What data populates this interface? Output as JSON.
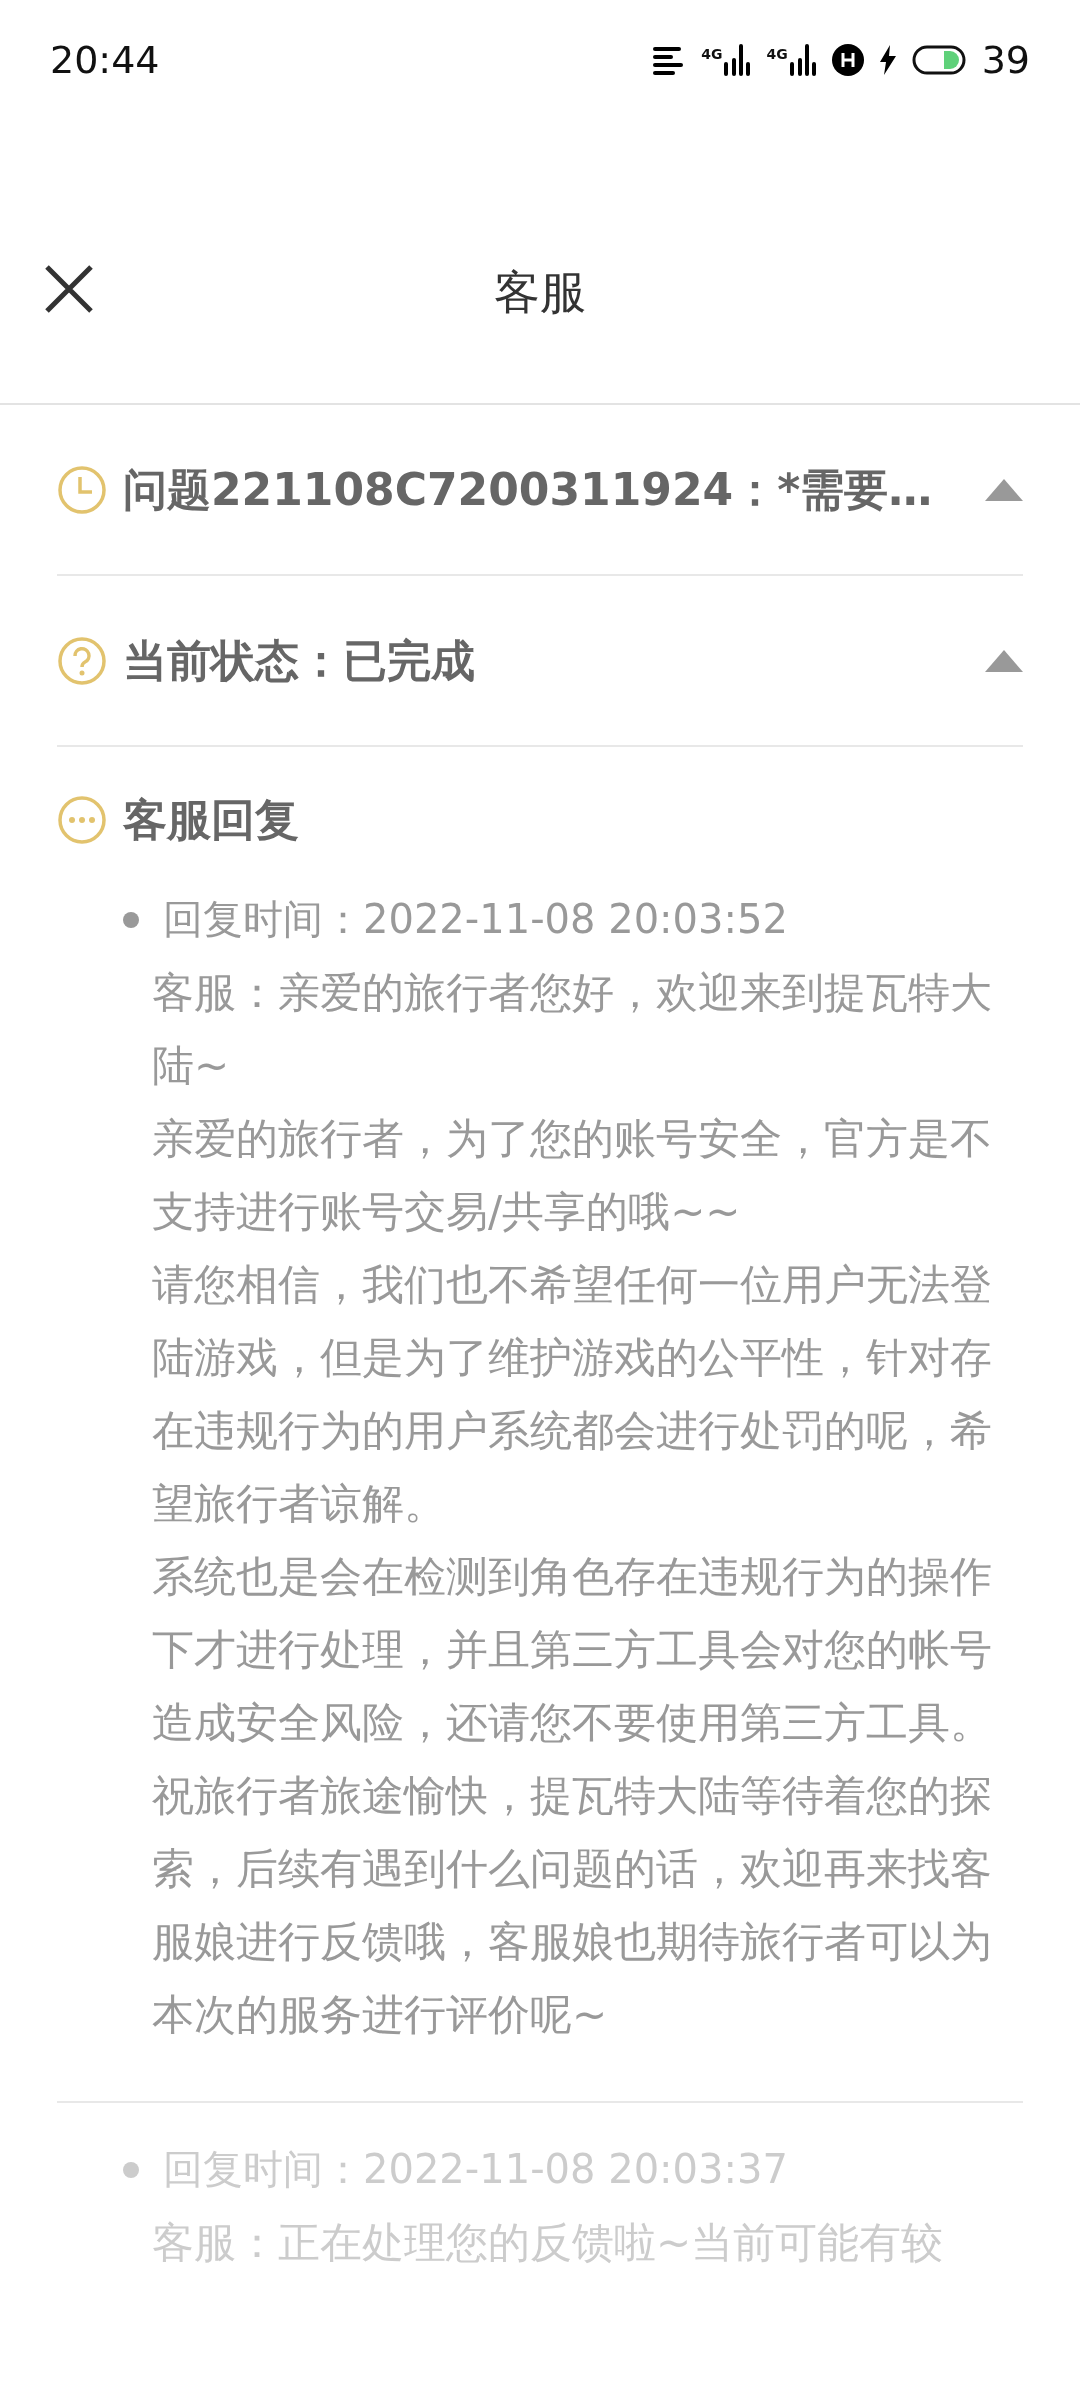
{
  "status_bar": {
    "time": "20:44",
    "network_1": "4G",
    "network_2": "4G",
    "battery": "39"
  },
  "header": {
    "title": "客服"
  },
  "rows": [
    {
      "kind": "clock",
      "text": "问题221108C7200311924：*需要…",
      "expanded": true
    },
    {
      "kind": "question",
      "text": "当前状态：已完成",
      "expanded": true
    }
  ],
  "section": {
    "title": "客服回复"
  },
  "replies": [
    {
      "time": "回复时间：2022-11-08 20:03:52",
      "dimmed": false,
      "paragraphs": [
        "客服：亲爱的旅行者您好，欢迎来到提瓦特大陆~",
        "亲爱的旅行者，为了您的账号安全，官方是不支持进行账号交易/共享的哦~~",
        "请您相信，我们也不希望任何一位用户无法登陆游戏，但是为了维护游戏的公平性，针对存在违规行为的用户系统都会进行处罚的呢，希望旅行者谅解。",
        "系统也是会在检测到角色存在违规行为的操作下才进行处理，并且第三方工具会对您的帐号造成安全风险，还请您不要使用第三方工具。",
        "祝旅行者旅途愉快，提瓦特大陆等待着您的探索，后续有遇到什么问题的话，欢迎再来找客服娘进行反馈哦，客服娘也期待旅行者可以为本次的服务进行评价呢~"
      ]
    },
    {
      "time": "回复时间：2022-11-08 20:03:37",
      "dimmed": true,
      "paragraphs": [
        "客服：正在处理您的反馈啦~当前可能有较"
      ]
    }
  ]
}
